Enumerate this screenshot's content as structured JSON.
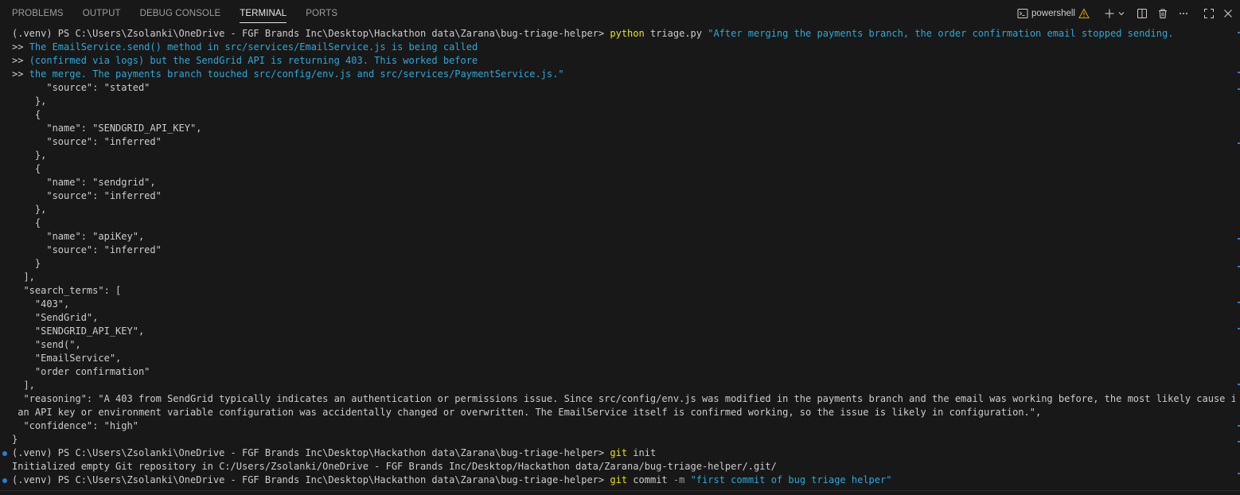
{
  "panel": {
    "tabs": [
      {
        "label": "PROBLEMS",
        "active": false
      },
      {
        "label": "OUTPUT",
        "active": false
      },
      {
        "label": "DEBUG CONSOLE",
        "active": false
      },
      {
        "label": "TERMINAL",
        "active": true
      },
      {
        "label": "PORTS",
        "active": false
      }
    ],
    "shell": {
      "label": "powershell",
      "icon": "terminal-icon",
      "warning_icon": "warning-icon"
    },
    "action_icons": [
      "add-icon",
      "chevron-down-icon",
      "split-icon",
      "trash-icon",
      "ellipsis-icon",
      "maximize-icon",
      "close-icon"
    ]
  },
  "terminal": {
    "prompt": "(.venv) PS C:\\Users\\Zsolanki\\OneDrive - FGF Brands Inc\\Desktop\\Hackathon data\\Zarana\\bug-triage-helper>",
    "cmd1": {
      "program": "python",
      "args": "triage.py",
      "string": "\"After merging the payments branch, the order confirmation email stopped sending."
    },
    "continuation_marker": ">>",
    "cmd1_cont": [
      "The EmailService.send() method in src/services/EmailService.js is being called",
      "(confirmed via logs) but the SendGrid API is returning 403. This worked before",
      "the merge. The payments branch touched src/config/env.js and src/services/PaymentService.js.\""
    ],
    "output": [
      "      \"source\": \"stated\"",
      "    },",
      "    {",
      "      \"name\": \"SENDGRID_API_KEY\",",
      "      \"source\": \"inferred\"",
      "    },",
      "    {",
      "      \"name\": \"sendgrid\",",
      "      \"source\": \"inferred\"",
      "    },",
      "    {",
      "      \"name\": \"apiKey\",",
      "      \"source\": \"inferred\"",
      "    }",
      "  ],",
      "  \"search_terms\": [",
      "    \"403\",",
      "    \"SendGrid\",",
      "    \"SENDGRID_API_KEY\",",
      "    \"send(\",",
      "    \"EmailService\",",
      "    \"order confirmation\"",
      "  ],",
      "  \"reasoning\": \"A 403 from SendGrid typically indicates an authentication or permissions issue. Since src/config/env.js was modified in the payments branch and the email was working before, the most likely cause is that",
      " an API key or environment variable configuration was accidentally changed or overwritten. The EmailService itself is confirmed working, so the issue is likely in configuration.\",",
      "  \"confidence\": \"high\"",
      "}"
    ],
    "cmd2": {
      "program": "git",
      "args": "init"
    },
    "cmd2_output": "Initialized empty Git repository in C:/Users/Zsolanki/OneDrive - FGF Brands Inc/Desktop/Hackathon data/Zarana/bug-triage-helper/.git/",
    "cmd3": {
      "program": "git",
      "args": "commit",
      "flag": "-m",
      "string": "\"first commit of bug triage helper\""
    }
  },
  "colors": {
    "background": "#181818",
    "text": "#cccccc",
    "command_yellow": "#e5e510",
    "string_cyan": "#2ea8d6",
    "decoration_blue": "#2b7ecf",
    "warning": "#cca700"
  }
}
